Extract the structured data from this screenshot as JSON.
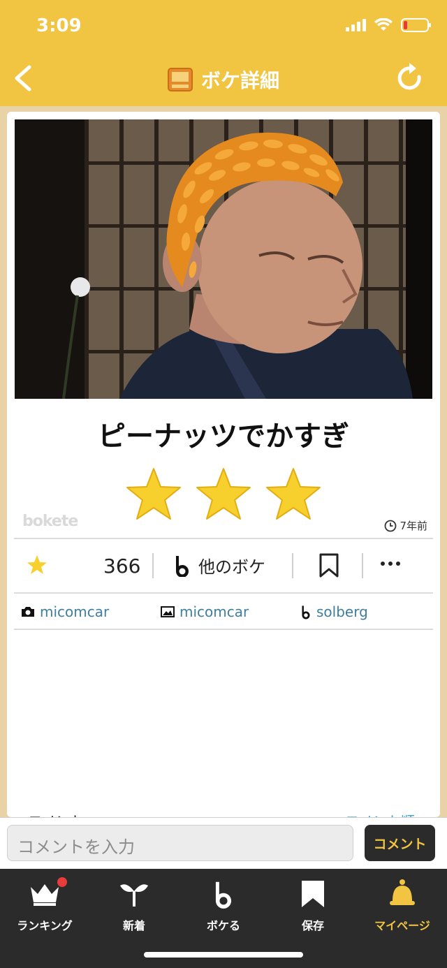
{
  "status_bar": {
    "time": "3:09"
  },
  "header": {
    "title": "ボケ詳細"
  },
  "post": {
    "caption": "ピーナッツでかすぎ",
    "star_rating": 3,
    "watermark": "bokete",
    "posted_ago": "7年前"
  },
  "actions": {
    "rating_count": "366",
    "other_boke_label": "他のボケ"
  },
  "credits": {
    "photographer": "micomcar",
    "image_by": "micomcar",
    "boke_by": "solberg"
  },
  "comments": {
    "heading": "コメント",
    "sort_label": "コメント順"
  },
  "comment_input": {
    "placeholder": "コメントを入力",
    "submit_label": "コメント"
  },
  "tabs": [
    {
      "label": "ランキング",
      "icon": "crown-icon",
      "has_badge": true
    },
    {
      "label": "新着",
      "icon": "sprout-icon"
    },
    {
      "label": "ボケる",
      "icon": "bokete-b-icon"
    },
    {
      "label": "保存",
      "icon": "bookmark-icon"
    },
    {
      "label": "マイページ",
      "icon": "mypage-bell-icon",
      "active": true
    }
  ],
  "colors": {
    "brand_yellow": "#f1c541",
    "dark": "#2b2b2b",
    "link_blue": "#3f7f9e",
    "star_yellow": "#f7d02e"
  }
}
